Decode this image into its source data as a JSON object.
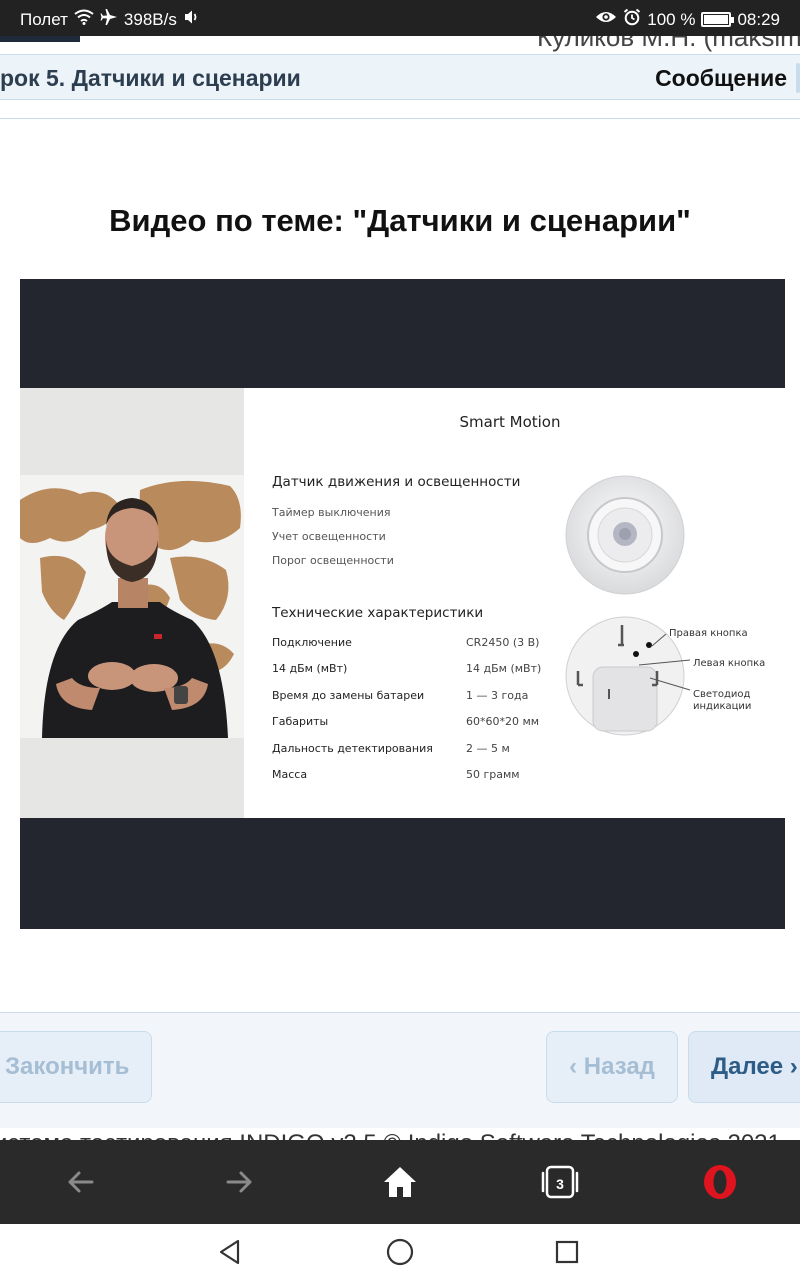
{
  "status_bar": {
    "carrier": "Полет",
    "speed": "398B/s",
    "battery": "100 %",
    "time": "08:29"
  },
  "header": {
    "user_name": "Куликов М.Н. (maksim",
    "lesson_title": "рок 5. Датчики и сценарии",
    "message_label": "Сообщение"
  },
  "page_title": "Видео по теме: \"Датчики и сценарии\"",
  "video": {
    "slide_title": "Smart Motion",
    "section1_title": "Датчик движения и освещенности",
    "section1_items": [
      "Таймер выключения",
      "Учет освещенности",
      "Порог освещенности"
    ],
    "section2_title": "Технические характеристики",
    "specs": [
      {
        "label": "Подключение",
        "value": "CR2450 (3 В)"
      },
      {
        "label": "14 дБм (мВт)",
        "value": "14 дБм (мВт)"
      },
      {
        "label": "Время до замены батареи",
        "value": "1 — 3 года"
      },
      {
        "label": "Габариты",
        "value": "60*60*20 мм"
      },
      {
        "label": "Дальность детектирования",
        "value": "2 — 5 м"
      },
      {
        "label": "Масса",
        "value": "50 грамм"
      }
    ],
    "annotations": {
      "right_button": "Правая кнопка",
      "left_button": "Левая кнопка",
      "led_line1": "Светодиод",
      "led_line2": "индикации"
    }
  },
  "footer": {
    "finish_label": "Закончить",
    "back_label": "‹ Назад",
    "next_label": "Далее ›",
    "copyright": "истема тестирования INDIGO v2.5 © Indigo Software Technologies 2021"
  },
  "browser_bar": {
    "tab_count": "3"
  },
  "colors": {
    "status_bar_bg": "#222222",
    "header_bg": "#ecf3f9",
    "video_bg": "#23262f",
    "browser_bar_bg": "#2a2a2a",
    "opera_red": "#e0141e",
    "next_text": "#2d5d86",
    "disabled_text": "#a6bed4"
  }
}
